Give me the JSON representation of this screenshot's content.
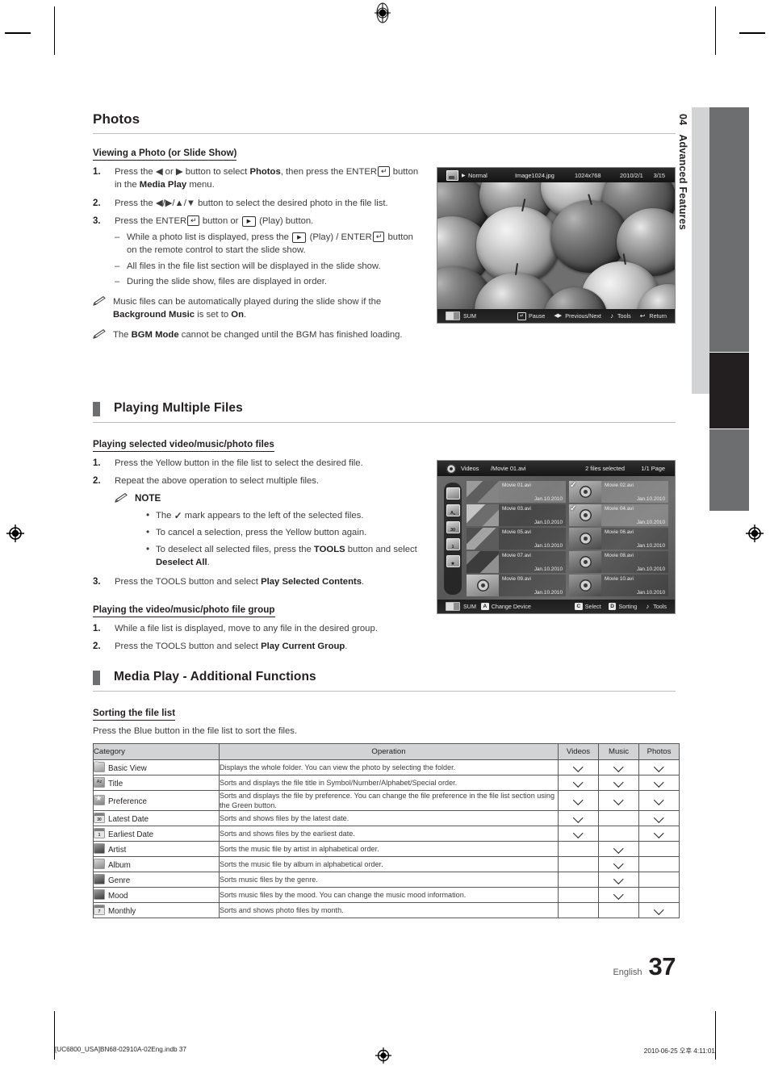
{
  "chapter_tab": {
    "number": "04",
    "title": "Advanced Features"
  },
  "section": {
    "title": "Photos",
    "sub1": {
      "heading": "Viewing a Photo (or Slide Show)",
      "steps": [
        {
          "n": "1.",
          "html": "Press the ◀ or ▶ button to select <b>Photos</b>, then press the ENTER<span class=\"keyenter\">↵</span> button in the <b>Media Play</b> menu."
        },
        {
          "n": "2.",
          "html": "Press the ◀/▶/▲/▼ button to select the desired photo in the file list."
        },
        {
          "n": "3.",
          "html": "Press the ENTER<span class=\"keyenter\">↵</span> button or <span class=\"keyplay\">▶</span> (Play) button."
        }
      ],
      "dashes": [
        "While a photo list is displayed, press the <span class=\"keyplay\">▶</span> (Play) / ENTER<span class=\"keyenter\">↵</span> button on the remote control to start the slide show.",
        "All files in the file list section will be displayed in the slide show.",
        "During the slide show, files are displayed in order."
      ],
      "notes": [
        "Music files can be automatically played during the slide show if the <b>Background Music</b> is set to <b>On</b>.",
        "The <b>BGM Mode</b> cannot be changed until the BGM has finished loading."
      ]
    }
  },
  "section2": {
    "title": "Playing Multiple Files",
    "sub1": {
      "heading": "Playing selected video/music/photo files",
      "steps": [
        {
          "n": "1.",
          "html": "Press the Yellow button in the file list to select the desired file."
        },
        {
          "n": "2.",
          "html": "Repeat the above operation to select multiple files."
        },
        {
          "n": "3.",
          "html": "Press the TOOLS button and select <b>Play Selected Contents</b>."
        }
      ],
      "note_title": "NOTE",
      "bullets": [
        "The <span class=\"chk\">✓</span> mark appears to the left of the selected files.",
        "To cancel a selection, press the Yellow button again.",
        "To deselect all selected files, press the <b>TOOLS</b> button and select <b>Deselect All</b>."
      ]
    },
    "sub2": {
      "heading": "Playing the video/music/photo file group",
      "steps": [
        {
          "n": "1.",
          "html": "While a file list is displayed, move to any file in the desired group."
        },
        {
          "n": "2.",
          "html": "Press the TOOLS button and select <b>Play Current Group</b>."
        }
      ]
    }
  },
  "section3": {
    "title": "Media Play - Additional Functions",
    "sub1": {
      "heading": "Sorting the file list",
      "intro": "Press the Blue button in the file list to sort the files."
    }
  },
  "photo_osd": {
    "mode": "Normal",
    "filename": "Image1024.jpg",
    "resolution": "1024x768",
    "date": "2010/2/1",
    "index": "3/15",
    "device": "SUM",
    "actions": [
      {
        "glyph": "↵",
        "label": "Pause",
        "type": "key"
      },
      {
        "glyph": "◀▶",
        "label": "Previous/Next",
        "type": "lr"
      },
      {
        "glyph": "♪",
        "label": "Tools",
        "type": "tools"
      },
      {
        "glyph": "↩",
        "label": "Return",
        "type": "ret"
      }
    ]
  },
  "filelist_osd": {
    "section_label": "Videos",
    "current": "/Movie 01.avi",
    "selected_count": "2 files selected",
    "page": "1/1 Page",
    "device": "SUM",
    "change_device": "Change Device",
    "change_device_key": "A",
    "sidebar_icons": [
      "folder-icon",
      "title-icon",
      "latest-date-icon",
      "earliest-date-icon",
      "preference-star-icon"
    ],
    "sidebar_labels": [
      "",
      "A-z",
      "30",
      "1",
      ""
    ],
    "files": [
      {
        "name": "Movie 01.avi",
        "date": "Jan.10.2010",
        "thumb": "photo",
        "checked": false,
        "selected": true
      },
      {
        "name": "Movie 02.avi",
        "date": "Jan.10.2010",
        "thumb": "reel",
        "checked": true,
        "selected": true
      },
      {
        "name": "Movie 03.avi",
        "date": "Jan.10.2010",
        "thumb": "photo",
        "checked": false,
        "selected": false
      },
      {
        "name": "Movie 04.avi",
        "date": "Jan.10.2010",
        "thumb": "reel",
        "checked": true,
        "selected": true
      },
      {
        "name": "Movie 05.avi",
        "date": "Jan.10.2010",
        "thumb": "photo",
        "checked": false,
        "selected": false
      },
      {
        "name": "Movie 06.avi",
        "date": "Jan.10.2010",
        "thumb": "reel",
        "checked": false,
        "selected": false
      },
      {
        "name": "Movie 07.avi",
        "date": "Jan.10.2010",
        "thumb": "photo",
        "checked": false,
        "selected": false
      },
      {
        "name": "Movie 08.avi",
        "date": "Jan.10.2010",
        "thumb": "reel",
        "checked": false,
        "selected": false
      },
      {
        "name": "Movie 09.avi",
        "date": "Jan.10.2010",
        "thumb": "reel",
        "checked": false,
        "selected": false
      },
      {
        "name": "Movie 10.avi",
        "date": "Jan.10.2010",
        "thumb": "reel",
        "checked": false,
        "selected": false
      }
    ],
    "actions": [
      {
        "key": "C",
        "label": "Select"
      },
      {
        "key": "D",
        "label": "Sorting"
      },
      {
        "key": "♪",
        "label": "Tools"
      }
    ]
  },
  "sort_table": {
    "headers": [
      "Category",
      "Operation",
      "Videos",
      "Music",
      "Photos"
    ],
    "rows": [
      {
        "icon": "folder-icon",
        "category": "Basic View",
        "operation": "Displays the whole folder. You can view the photo by selecting the folder.",
        "videos": true,
        "music": true,
        "photos": true
      },
      {
        "icon": "title-icon",
        "category": "Title",
        "operation": "Sorts and displays the file title in Symbol/Number/Alphabet/Special order.",
        "videos": true,
        "music": true,
        "photos": true
      },
      {
        "icon": "star-icon",
        "category": "Preference",
        "operation": "Sorts and displays the file by preference. You can change the file preference in the file list section using the Green button.",
        "videos": true,
        "music": true,
        "photos": true
      },
      {
        "icon": "calendar-30-icon",
        "category": "Latest Date",
        "operation": "Sorts and shows files by the latest date.",
        "videos": true,
        "music": false,
        "photos": true
      },
      {
        "icon": "calendar-1-icon",
        "category": "Earliest Date",
        "operation": "Sorts and shows files by the earliest date.",
        "videos": true,
        "music": false,
        "photos": true
      },
      {
        "icon": "artist-icon",
        "category": "Artist",
        "operation": "Sorts the music file by artist in alphabetical order.",
        "videos": false,
        "music": true,
        "photos": false
      },
      {
        "icon": "album-icon",
        "category": "Album",
        "operation": "Sorts the music file by album in alphabetical order.",
        "videos": false,
        "music": true,
        "photos": false
      },
      {
        "icon": "genre-icon",
        "category": "Genre",
        "operation": "Sorts music files by the genre.",
        "videos": false,
        "music": true,
        "photos": false
      },
      {
        "icon": "mood-icon",
        "category": "Mood",
        "operation": "Sorts music files by the mood. You can change the music mood information.",
        "videos": false,
        "music": true,
        "photos": false
      },
      {
        "icon": "calendar-7-icon",
        "category": "Monthly",
        "operation": "Sorts and shows photo files by month.",
        "videos": false,
        "music": false,
        "photos": true
      }
    ]
  },
  "footer": {
    "language": "English",
    "page_number": "37",
    "print_left": "[UC6800_USA]BN68-02910A-02Eng.indb   37",
    "print_right": "2010-06-25   오후 4:11:01"
  }
}
